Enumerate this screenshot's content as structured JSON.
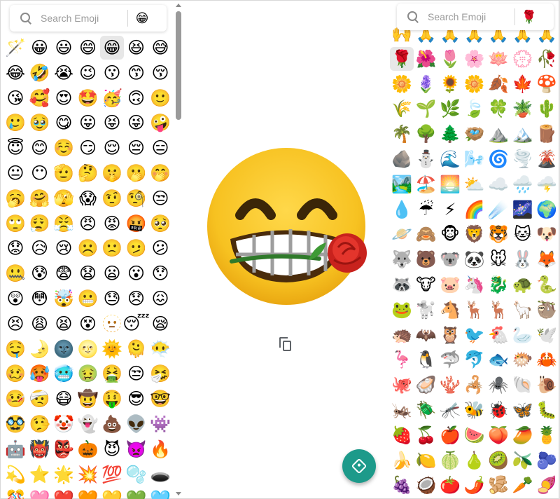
{
  "left_search": {
    "placeholder": "Search Emoji",
    "selected_emoji": "😁"
  },
  "right_search": {
    "placeholder": "Search Emoji",
    "selected_emoji": "🌹"
  },
  "left_emojis": [
    "🪄",
    "😀",
    "😃",
    "😄",
    "😁",
    "😆",
    "😅",
    "😂",
    "🤣",
    "😭",
    "😉",
    "😗",
    "😙",
    "😚",
    "😘",
    "🥰",
    "😍",
    "🤩",
    "🥳",
    "🙃",
    "🙂",
    "🥲",
    "🥹",
    "😋",
    "😛",
    "😝",
    "😜",
    "🤪",
    "😇",
    "😊",
    "☺️",
    "😏",
    "😌",
    "😔",
    "😑",
    "😐",
    "😶",
    "🫡",
    "🤔",
    "🤫",
    "🫢",
    "🤭",
    "🥱",
    "🤗",
    "🫣",
    "😱",
    "🤨",
    "🧐",
    "😒",
    "🙄",
    "😮‍💨",
    "😤",
    "😠",
    "😡",
    "🤬",
    "🥺",
    "😟",
    "😥",
    "😢",
    "☹️",
    "🙁",
    "🫤",
    "😕",
    "🤐",
    "😰",
    "😨",
    "😧",
    "😦",
    "😮",
    "😯",
    "😲",
    "😳",
    "🤯",
    "😬",
    "😓",
    "😞",
    "😖",
    "😣",
    "😩",
    "😫",
    "😵",
    "🫥",
    "😴",
    "😪",
    "🤤",
    "🌛",
    "🌚",
    "🌝",
    "🌞",
    "🫠",
    "😶‍🌫️",
    "🥴",
    "🥵",
    "🥶",
    "🤢",
    "🤮",
    "😒",
    "🤧",
    "🤒",
    "🤕",
    "😷",
    "🤠",
    "🤑",
    "😎",
    "🤓",
    "🥸",
    "🤥",
    "🤡",
    "👻",
    "💩",
    "👽",
    "👾",
    "🤖",
    "👹",
    "👺",
    "🎃",
    "😈",
    "👿",
    "🔥",
    "💫",
    "⭐",
    "🌟",
    "💥",
    "💯",
    "🫧",
    "🕳️",
    "🎊",
    "🩷",
    "❤️",
    "🧡",
    "💛",
    "💚",
    "🩵"
  ],
  "right_emojis": [
    "🙌",
    "🙏",
    "🙏",
    "🙏",
    "🙏",
    "🙏",
    "🙏",
    "🌹",
    "🌺",
    "🌷",
    "🌸",
    "🪷",
    "💮",
    "🥀",
    "🌼",
    "🪻",
    "🌻",
    "🌼",
    "🍂",
    "🍁",
    "🍄",
    "🌾",
    "🌱",
    "🌿",
    "🍃",
    "🍀",
    "🪴",
    "🌵",
    "🌴",
    "🌳",
    "🌲",
    "🪺",
    "⛰️",
    "🏔️",
    "🪵",
    "🪨",
    "⛄",
    "🌊",
    "🌬️",
    "🌀",
    "🌪️",
    "🌋",
    "🏞️",
    "🏖️",
    "🌅",
    "⛅",
    "☁️",
    "🌧️",
    "🌩️",
    "💧",
    "☔",
    "⚡",
    "🌈",
    "☄️",
    "🌌",
    "🌍",
    "🪐",
    "🙈",
    "🐵",
    "🦁",
    "🐯",
    "🐱",
    "🐶",
    "🐺",
    "🐻",
    "🐨",
    "🐼",
    "🐭",
    "🐰",
    "🦊",
    "🦝",
    "🐮",
    "🐷",
    "🦄",
    "🐉",
    "🐢",
    "🐍",
    "🐸",
    "🐩",
    "🐴",
    "🦌",
    "🦌",
    "🦙",
    "🦥",
    "🦔",
    "🦇",
    "🦉",
    "🐦",
    "🐔",
    "🦢",
    "🕊️",
    "🦩",
    "🐧",
    "🦈",
    "🐬",
    "🐟",
    "🐡",
    "🦀",
    "🐙",
    "🦪",
    "🪸",
    "🦂",
    "🕷️",
    "🐚",
    "🐌",
    "🦗",
    "🪲",
    "🦟",
    "🐝",
    "🐞",
    "🦋",
    "🐛",
    "🍓",
    "🍒",
    "🍎",
    "🍉",
    "🍑",
    "🥭",
    "🍍",
    "🍌",
    "🍋",
    "🍈",
    "🍐",
    "🥝",
    "🫒",
    "🫐",
    "🍇",
    "🥥",
    "🍅",
    "🌶️",
    "🫚",
    "🥕",
    "🍠"
  ],
  "selected": {
    "left_index": 4,
    "right_index": 7,
    "combined_name": "beaming face with rose"
  }
}
